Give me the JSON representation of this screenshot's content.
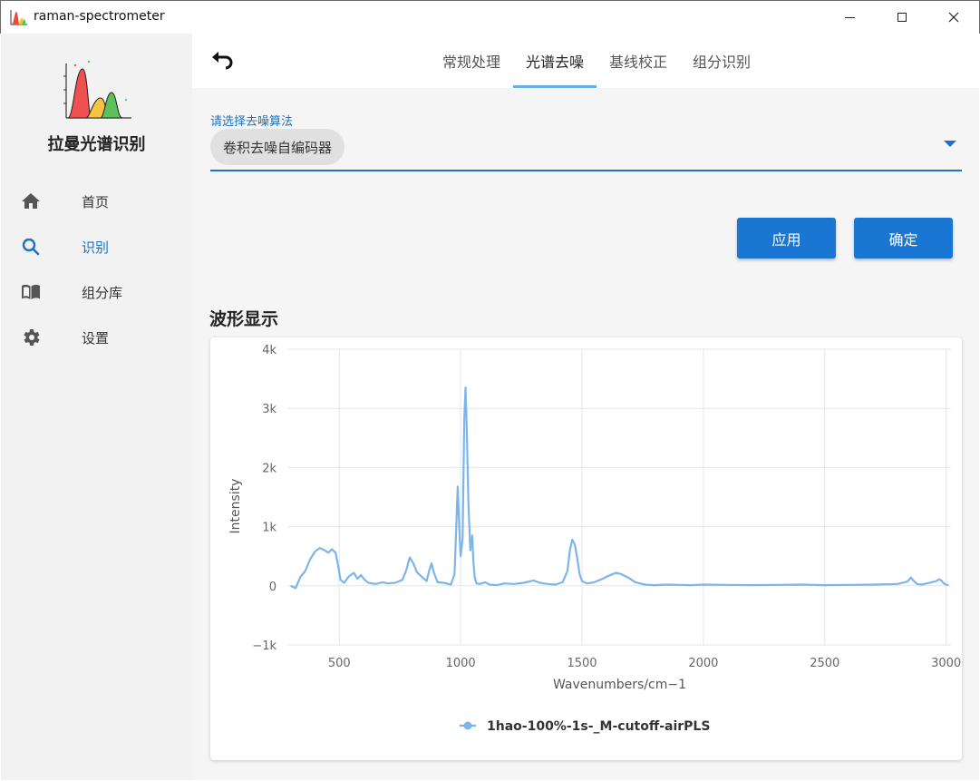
{
  "window": {
    "title": "raman-spectrometer"
  },
  "sidebar": {
    "brand": "拉曼光谱识别",
    "items": [
      {
        "label": "首页",
        "icon": "home-icon",
        "active": false
      },
      {
        "label": "识别",
        "icon": "search-icon",
        "active": true
      },
      {
        "label": "组分库",
        "icon": "book-icon",
        "active": false
      },
      {
        "label": "设置",
        "icon": "gear-icon",
        "active": false
      }
    ]
  },
  "tabs": [
    {
      "label": "常规处理",
      "active": false
    },
    {
      "label": "光谱去噪",
      "active": true
    },
    {
      "label": "基线校正",
      "active": false
    },
    {
      "label": "组分识别",
      "active": false
    }
  ],
  "denoise": {
    "label": "请选择去噪算法",
    "selected": "卷积去噪自编码器"
  },
  "buttons": {
    "apply": "应用",
    "confirm": "确定"
  },
  "section": {
    "waveform_title": "波形显示"
  },
  "colors": {
    "accent": "#1976d2",
    "series": "#7cb5ec"
  },
  "chart_data": {
    "type": "line",
    "xlabel": "Wavenumbers/cm−1",
    "ylabel": "Intensity",
    "xlim": [
      290,
      3020
    ],
    "ylim": [
      -1000,
      4000
    ],
    "xticks": [
      500,
      1000,
      1500,
      2000,
      2500,
      3000
    ],
    "yticks": [
      -1000,
      0,
      1000,
      2000,
      3000,
      4000
    ],
    "ytick_labels": [
      "−1k",
      "0",
      "1k",
      "2k",
      "3k",
      "4k"
    ],
    "grid": true,
    "legend": "bottom",
    "series": [
      {
        "name": "1hao-100%-1s-_M-cutoff-airPLS",
        "color": "#7cb5ec",
        "x": [
          300,
          320,
          340,
          360,
          380,
          400,
          420,
          440,
          455,
          470,
          485,
          495,
          505,
          520,
          540,
          560,
          575,
          590,
          605,
          620,
          650,
          680,
          700,
          730,
          760,
          775,
          790,
          805,
          820,
          840,
          860,
          870,
          880,
          890,
          905,
          930,
          960,
          975,
          982,
          988,
          995,
          1000,
          1008,
          1015,
          1020,
          1025,
          1032,
          1040,
          1048,
          1052,
          1058,
          1065,
          1080,
          1100,
          1120,
          1150,
          1180,
          1220,
          1260,
          1300,
          1320,
          1340,
          1360,
          1390,
          1420,
          1440,
          1450,
          1460,
          1470,
          1480,
          1490,
          1500,
          1520,
          1550,
          1580,
          1610,
          1640,
          1660,
          1690,
          1720,
          1760,
          1800,
          1850,
          1900,
          1950,
          2000,
          2100,
          2200,
          2300,
          2400,
          2500,
          2600,
          2700,
          2800,
          2840,
          2855,
          2865,
          2880,
          2900,
          2920,
          2940,
          2960,
          2970,
          2980,
          2990,
          3000,
          3010
        ],
        "y": [
          0,
          -40,
          150,
          250,
          450,
          580,
          640,
          600,
          560,
          620,
          560,
          350,
          100,
          50,
          160,
          220,
          120,
          180,
          100,
          50,
          30,
          60,
          40,
          50,
          100,
          250,
          480,
          380,
          230,
          150,
          80,
          250,
          380,
          220,
          60,
          50,
          20,
          200,
          1000,
          1680,
          900,
          500,
          800,
          2800,
          3350,
          2700,
          1400,
          600,
          850,
          450,
          150,
          40,
          30,
          60,
          20,
          10,
          40,
          30,
          50,
          90,
          60,
          40,
          30,
          20,
          60,
          250,
          600,
          780,
          700,
          480,
          200,
          80,
          40,
          60,
          110,
          170,
          220,
          200,
          140,
          60,
          20,
          10,
          20,
          15,
          10,
          20,
          15,
          10,
          15,
          20,
          10,
          15,
          20,
          30,
          70,
          140,
          90,
          30,
          20,
          40,
          60,
          80,
          110,
          90,
          40,
          20,
          10
        ]
      }
    ]
  }
}
